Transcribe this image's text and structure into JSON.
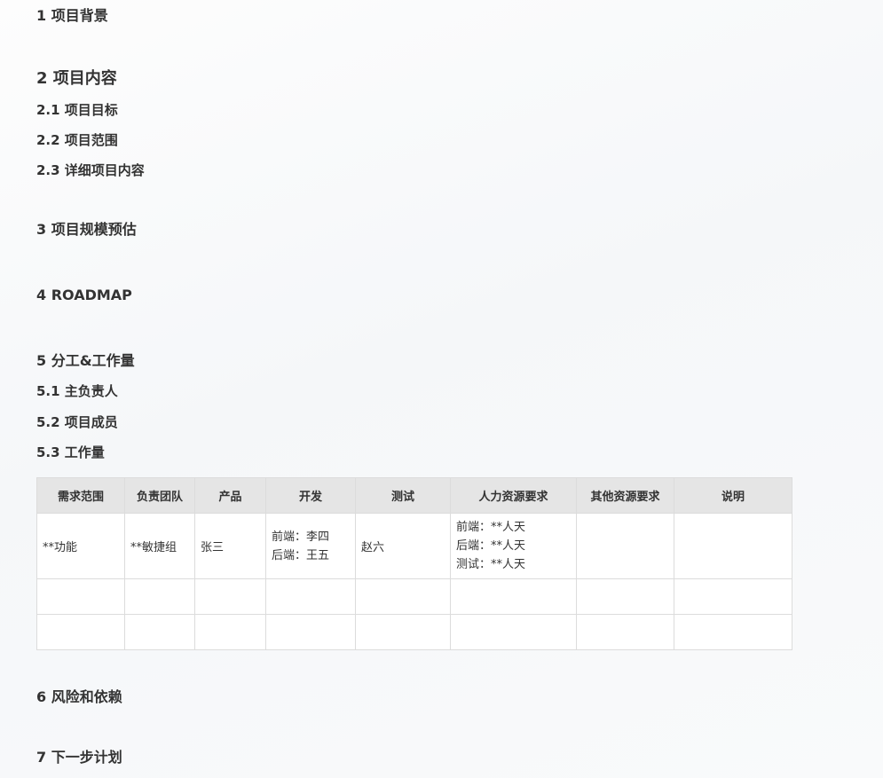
{
  "sections": {
    "s1": "1 项目背景",
    "s2": "2 项目内容",
    "s2_1": "2.1 项目目标",
    "s2_2": "2.2 项目范围",
    "s2_3": "2.3 详细项目内容",
    "s3": "3 项目规模预估",
    "s4": "4 ROADMAP",
    "s5": "5 分工&工作量",
    "s5_1": "5.1 主负责人",
    "s5_2": "5.2 项目成员",
    "s5_3": "5.3 工作量",
    "s6": "6 风险和依赖",
    "s7": "7 下一步计划"
  },
  "table": {
    "headers": [
      "需求范围",
      "负责团队",
      "产品",
      "开发",
      "测试",
      "人力资源要求",
      "其他资源要求",
      "说明"
    ],
    "row1": {
      "scope": "**功能",
      "team": "**敏捷组",
      "product": "张三",
      "dev_1": "前端：李四",
      "dev_2": "后端：王五",
      "test": "赵六",
      "hr_1": "前端：**人天",
      "hr_2": "后端：**人天",
      "hr_3": "测试：**人天",
      "other": "",
      "note": ""
    }
  }
}
